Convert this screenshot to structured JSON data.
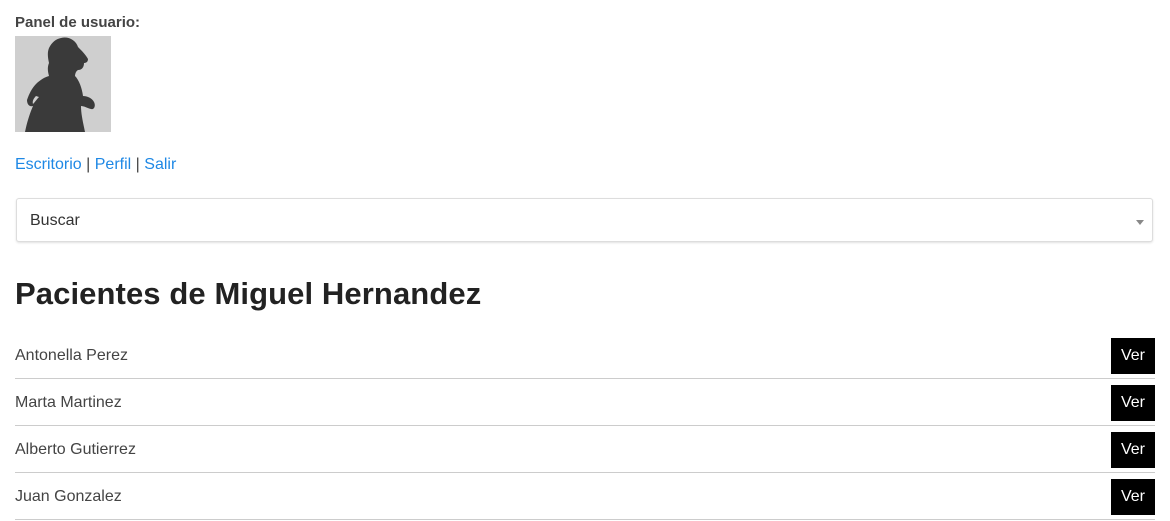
{
  "panel": {
    "label": "Panel de usuario:",
    "avatar_icon": "runner-silhouette-icon"
  },
  "nav": {
    "links": [
      {
        "label": "Escritorio"
      },
      {
        "label": "Perfil"
      },
      {
        "label": "Salir"
      }
    ],
    "separator": "|"
  },
  "search": {
    "selected_value": "Buscar"
  },
  "page": {
    "title": "Pacientes de Miguel Hernandez"
  },
  "patients": [
    {
      "name": "Antonella Perez",
      "button_label": "Ver"
    },
    {
      "name": "Marta Martinez",
      "button_label": "Ver"
    },
    {
      "name": "Alberto Gutierrez",
      "button_label": "Ver"
    },
    {
      "name": "Juan Gonzalez",
      "button_label": "Ver"
    }
  ],
  "colors": {
    "link": "#1e88e5",
    "button_bg": "#000000",
    "button_text": "#ffffff",
    "avatar_bg": "#cfcfcf",
    "avatar_figure": "#3a3a3a"
  }
}
